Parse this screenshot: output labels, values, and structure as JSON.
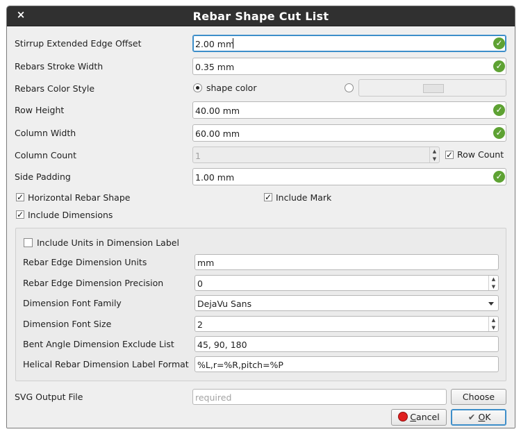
{
  "window": {
    "title": "Rebar Shape Cut List",
    "close_icon": "×"
  },
  "rows": {
    "stirrup_offset": {
      "label": "Stirrup Extended Edge Offset",
      "value": "2.00 mm"
    },
    "stroke_width": {
      "label": "Rebars Stroke Width",
      "value": "0.35 mm"
    },
    "color_style": {
      "label": "Rebars Color Style",
      "radio_shape": "shape color"
    },
    "row_height": {
      "label": "Row Height",
      "value": "40.00 mm"
    },
    "column_width": {
      "label": "Column Width",
      "value": "60.00 mm"
    },
    "column_count": {
      "label": "Column Count",
      "value": "1",
      "row_count_label": "Row Count"
    },
    "side_padding": {
      "label": "Side Padding",
      "value": "1.00 mm"
    }
  },
  "checks": {
    "horizontal_shape": "Horizontal Rebar Shape",
    "include_mark": "Include Mark",
    "include_dimensions": "Include Dimensions"
  },
  "dimensions": {
    "include_units": "Include Units in Dimension Label",
    "edge_units": {
      "label": "Rebar Edge Dimension Units",
      "value": "mm"
    },
    "edge_precision": {
      "label": "Rebar Edge Dimension Precision",
      "value": "0"
    },
    "font_family": {
      "label": "Dimension Font Family",
      "value": "DejaVu Sans"
    },
    "font_size": {
      "label": "Dimension Font Size",
      "value": "2"
    },
    "bent_angle": {
      "label": "Bent Angle Dimension Exclude List",
      "value": "45, 90, 180"
    },
    "helical_format": {
      "label": "Helical Rebar Dimension Label Format",
      "value": "%L,r=%R,pitch=%P"
    }
  },
  "output": {
    "label": "SVG Output File",
    "placeholder": "required",
    "choose": "Choose"
  },
  "buttons": {
    "cancel_first": "C",
    "cancel_rest": "ancel",
    "ok_first": "O",
    "ok_rest": "K"
  },
  "colors": {
    "accent": "#3d8ec9",
    "valid": "#5ea233",
    "cancel_icon": "#e02020"
  }
}
